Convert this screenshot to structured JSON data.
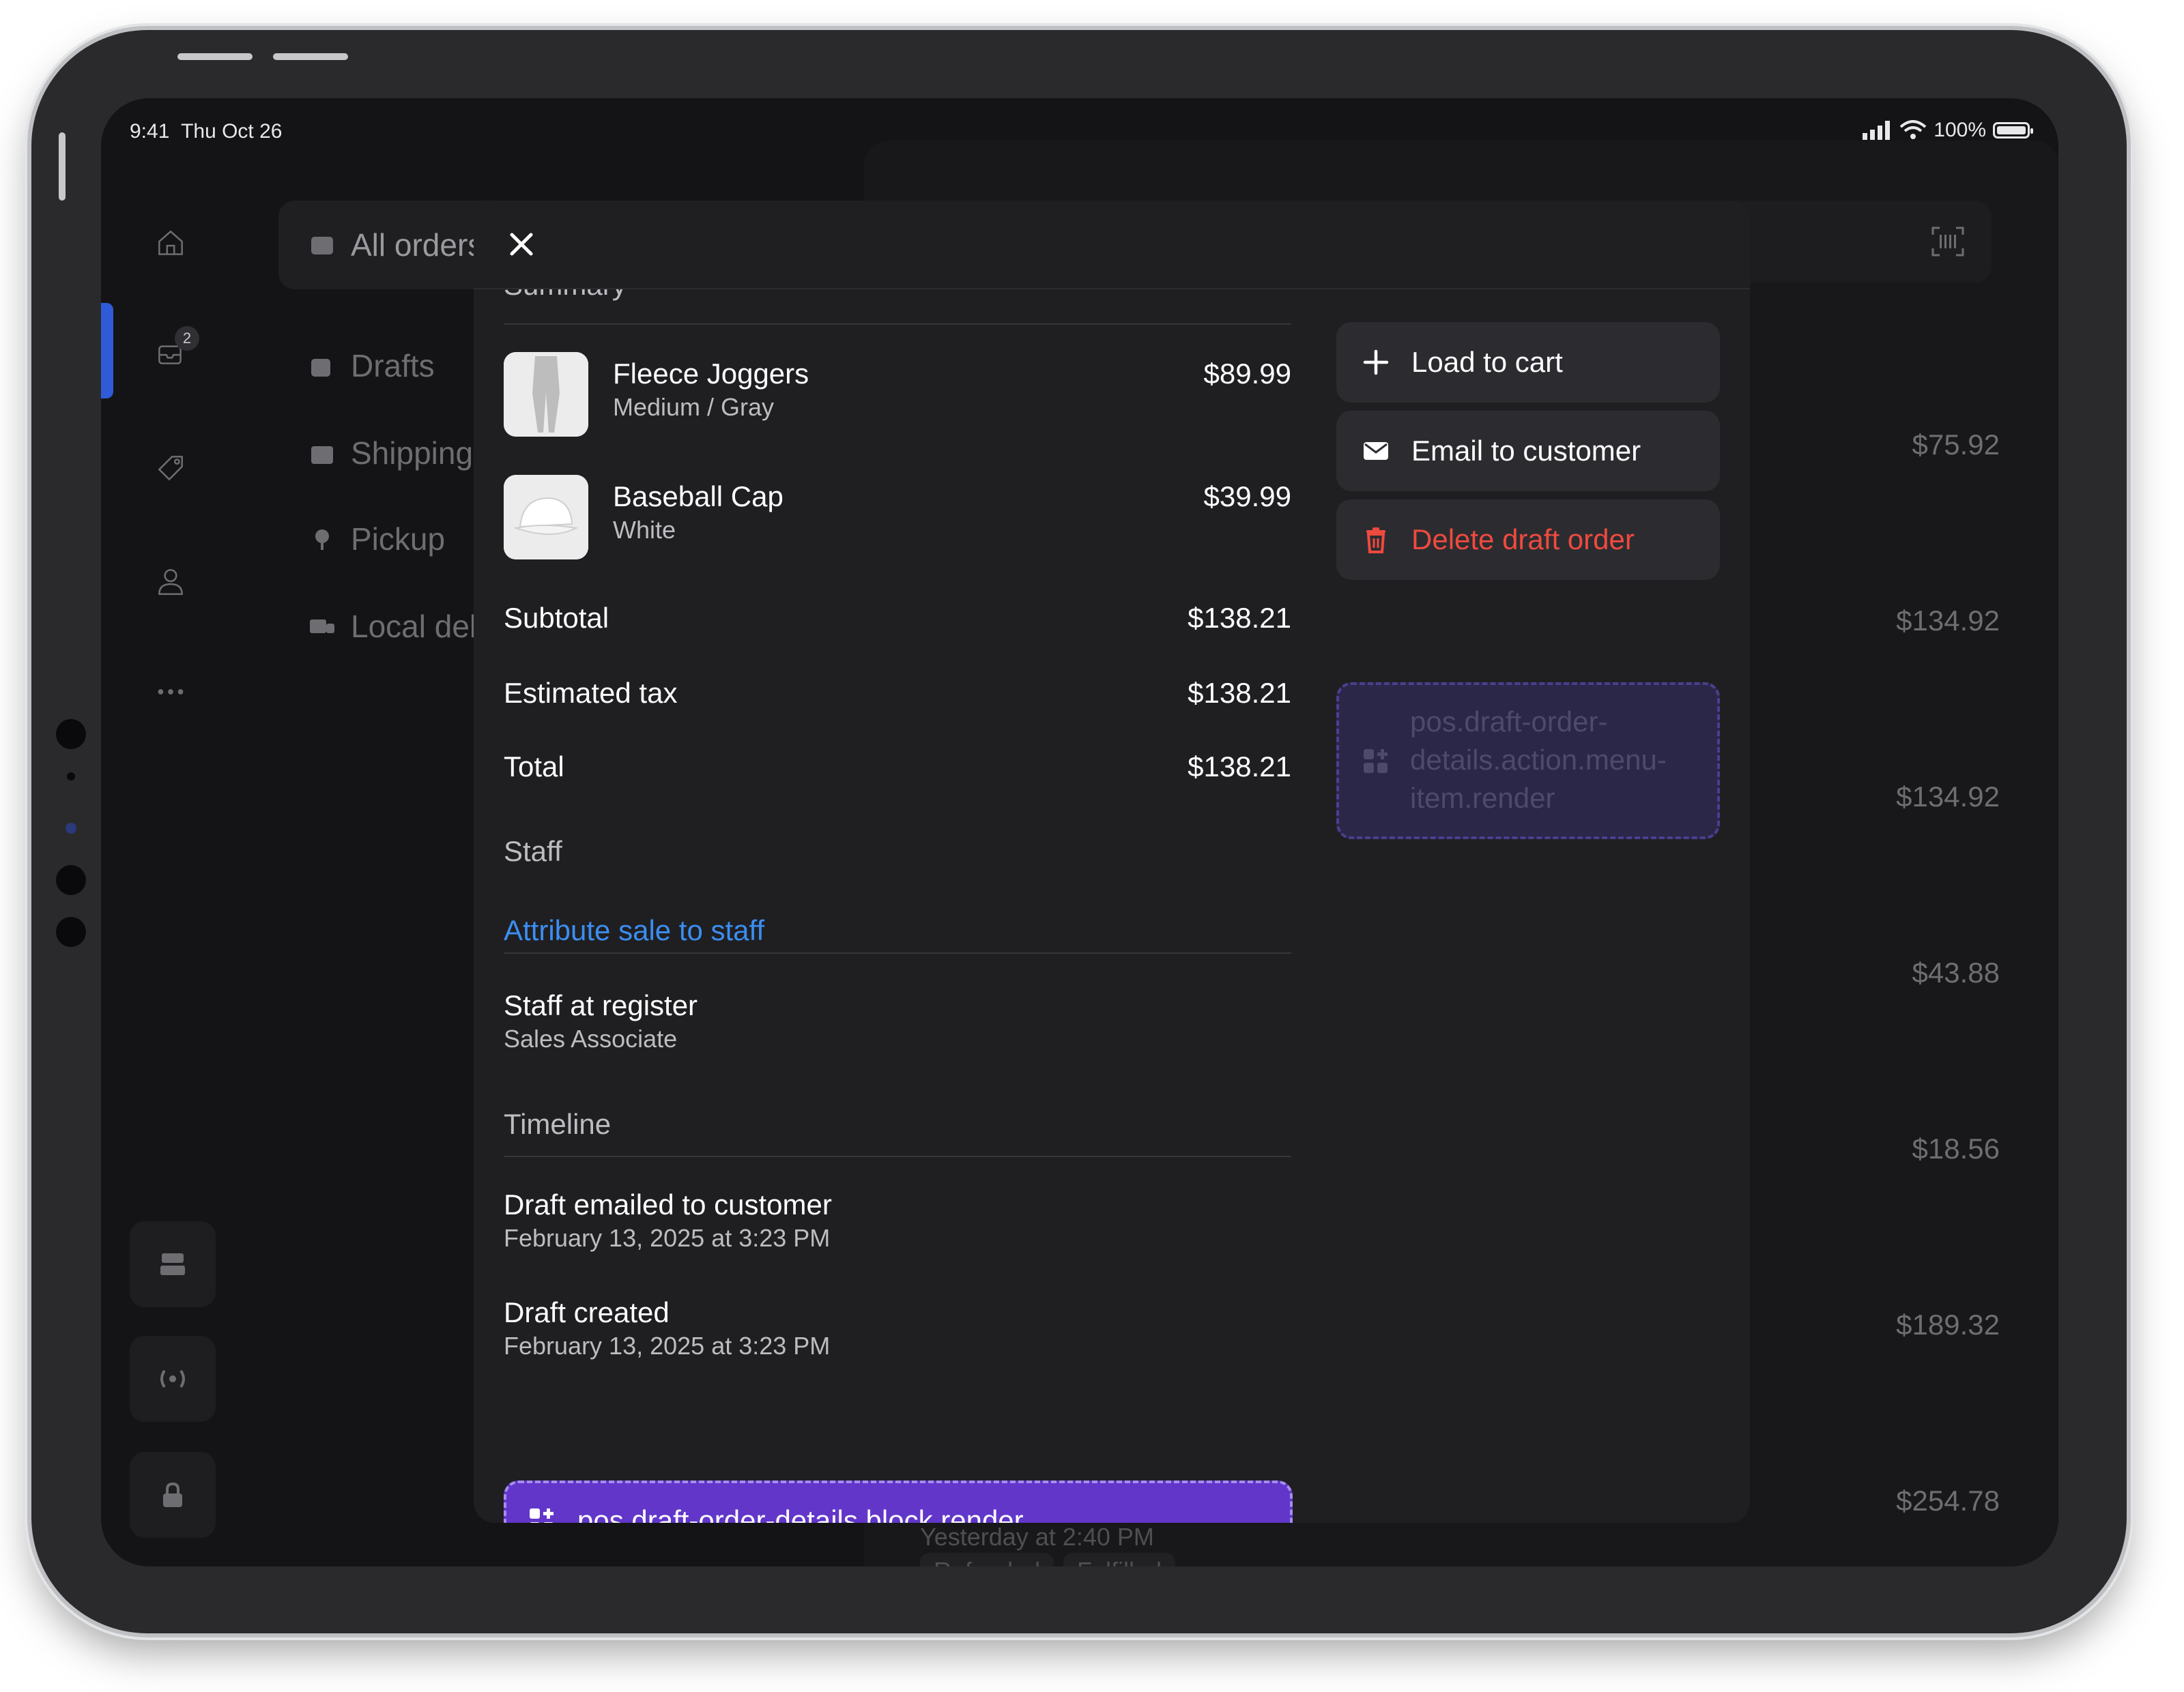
{
  "status_bar": {
    "time": "9:41",
    "date": "Thu Oct 26",
    "battery": "100%"
  },
  "rail": {
    "orders_badge": "2",
    "icons": [
      "home-icon",
      "orders-icon",
      "tag-icon",
      "person-icon",
      "more-icon",
      "register-icon",
      "broadcast-icon",
      "lock-icon"
    ]
  },
  "nav": {
    "items": [
      {
        "label": "All orders"
      },
      {
        "label": "Drafts"
      },
      {
        "label": "Shipping"
      },
      {
        "label": "Pickup"
      },
      {
        "label": "Local delivery"
      }
    ]
  },
  "background_list": {
    "prices": [
      "$75.92",
      "$134.92",
      "$134.92",
      "$43.88",
      "$18.56",
      "$189.32",
      "$254.78"
    ],
    "last_row": {
      "time": "Yesterday at 2:40 PM",
      "chips": [
        "Refunded",
        "Fulfilled"
      ]
    }
  },
  "modal": {
    "summary_title": "Summary",
    "items": [
      {
        "name": "Fleece Joggers",
        "variant": "Medium / Gray",
        "price": "$89.99"
      },
      {
        "name": "Baseball Cap",
        "variant": "White",
        "price": "$39.99"
      }
    ],
    "totals": [
      {
        "label": "Subtotal",
        "value": "$138.21"
      },
      {
        "label": "Estimated tax",
        "value": "$138.21"
      },
      {
        "label": "Total",
        "value": "$138.21"
      }
    ],
    "staff": {
      "title": "Staff",
      "attribute_link": "Attribute sale to staff",
      "register_label": "Staff at register",
      "register_role": "Sales Associate"
    },
    "timeline": {
      "title": "Timeline",
      "events": [
        {
          "title": "Draft emailed to customer",
          "time": "February 13, 2025 at 3:23 PM"
        },
        {
          "title": "Draft created",
          "time": "February 13, 2025 at 3:23 PM"
        }
      ]
    },
    "block_extension": "pos.draft-order-details.block.render",
    "actions": {
      "load_to_cart": "Load to cart",
      "email_to_customer": "Email to customer",
      "delete_draft_order": "Delete draft order",
      "menu_extension": "pos.draft-order-details.action.menu-item.render"
    }
  },
  "colors": {
    "accent_link": "#3b8ef0",
    "danger": "#ef4a3f",
    "extension": "#6236c9"
  }
}
